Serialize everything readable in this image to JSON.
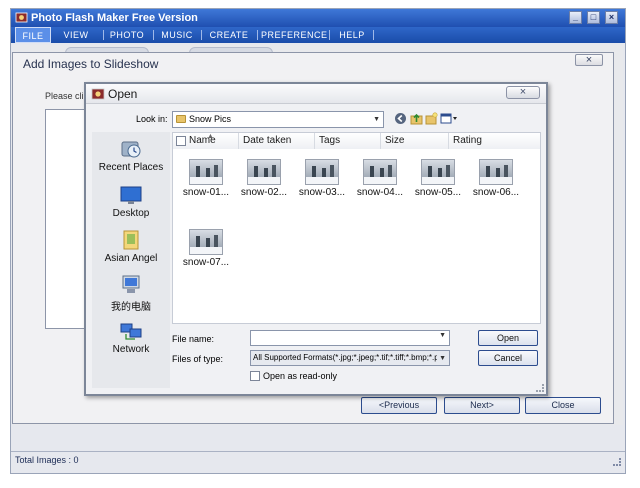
{
  "app": {
    "title": "Photo Flash Maker Free Version",
    "window_buttons": {
      "minimize": "_",
      "maximize": "□",
      "close": "×"
    }
  },
  "menu": {
    "items": [
      "FILE",
      "VIEW",
      "PHOTO",
      "MUSIC",
      "CREATE",
      "PREFERENCE",
      "HELP"
    ],
    "active": "FILE"
  },
  "status": {
    "text": "Total Images : 0"
  },
  "slideshow_dialog": {
    "title": "Add Images to Slideshow",
    "close_glyph": "×",
    "hint": "Please cli",
    "buttons": {
      "previous": "<Previous",
      "next": "Next>",
      "close": "Close"
    }
  },
  "open_dialog": {
    "title": "Open",
    "close_glyph": "×",
    "look_in_label": "Look in:",
    "look_in_value": "Snow Pics",
    "toolbar_icons": [
      "back-icon",
      "up-folder-icon",
      "new-folder-icon",
      "views-icon"
    ],
    "places": [
      {
        "label": "Recent Places",
        "icon": "recent-places-icon"
      },
      {
        "label": "Desktop",
        "icon": "desktop-icon"
      },
      {
        "label": "Asian Angel",
        "icon": "user-folder-icon"
      },
      {
        "label": "我的电脑",
        "icon": "computer-icon"
      },
      {
        "label": "Network",
        "icon": "network-icon"
      }
    ],
    "columns": [
      "Name",
      "Date taken",
      "Tags",
      "Size",
      "Rating"
    ],
    "files": [
      "snow-01...",
      "snow-02...",
      "snow-03...",
      "snow-04...",
      "snow-05...",
      "snow-06...",
      "snow-07..."
    ],
    "file_name_label": "File name:",
    "file_name_value": "",
    "files_of_type_label": "Files of type:",
    "files_of_type_value": "All Supported Formats(*.jpg;*.jpeg;*.tif;*.tiff;*.bmp;*.p",
    "read_only_label": "Open as read-only",
    "open_button": "Open",
    "cancel_button": "Cancel"
  },
  "colors": {
    "title_bar": "#1f4fb0",
    "menu_bar": "#1a4ca9",
    "dialog_border": "#7c8698"
  }
}
